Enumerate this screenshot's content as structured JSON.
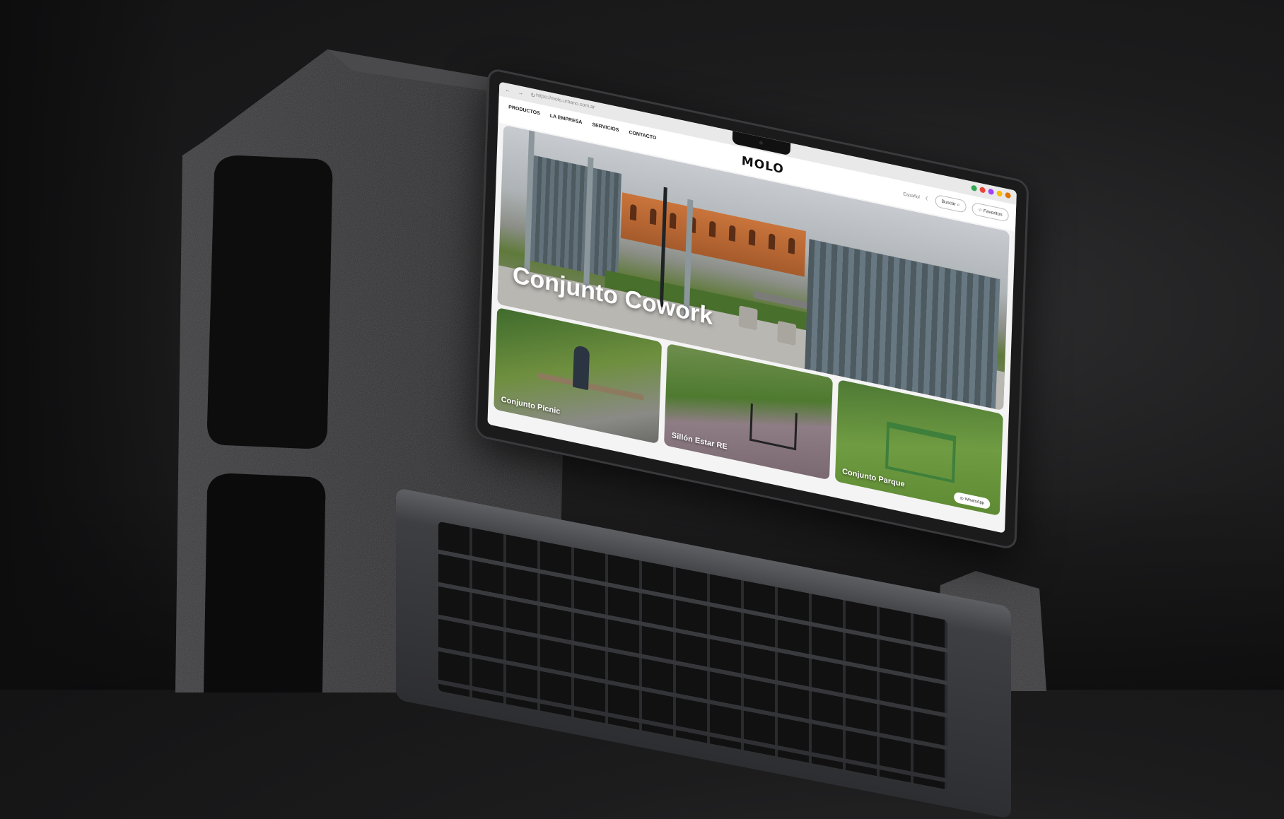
{
  "browser": {
    "url": "https://molo.urbano.com.ar",
    "nav_icons": "← → ↻"
  },
  "site": {
    "logo": "MOLO",
    "nav": [
      "PRODUCTOS",
      "LA EMPRESA",
      "SERVICIOS",
      "CONTACTO"
    ],
    "language": "Español",
    "search_label": "Buscar",
    "favorites_label": "Favoritos"
  },
  "hero": {
    "title": "Conjunto Cowork"
  },
  "cards": [
    {
      "label": "Conjunto Picnic"
    },
    {
      "label": "Sillón Estar RE"
    },
    {
      "label": "Conjunto Parque"
    }
  ],
  "whatsapp_label": "WhatsApp",
  "colors": {
    "background": "#1c1c1d",
    "screen_bg": "#f4f4f4",
    "lid": "#1b1b1c"
  }
}
